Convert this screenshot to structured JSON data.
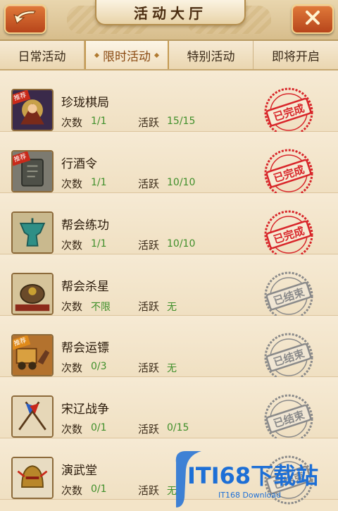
{
  "header": {
    "title": "活动大厅",
    "back_icon": "back-arrow-icon",
    "close_icon": "close-icon"
  },
  "tabs": [
    {
      "label": "日常活动",
      "active": false
    },
    {
      "label": "限时活动",
      "active": true
    },
    {
      "label": "特别活动",
      "active": false
    },
    {
      "label": "即将开启",
      "active": false
    }
  ],
  "labels": {
    "count": "次数",
    "activity": "活跃"
  },
  "activities": [
    {
      "name": "珍珑棋局",
      "count": "1/1",
      "activity": "15/15",
      "status": "已完成",
      "recommended": true,
      "icon": "warrior-portrait-icon"
    },
    {
      "name": "行酒令",
      "count": "1/1",
      "activity": "10/10",
      "status": "已完成",
      "recommended": true,
      "icon": "stone-tablet-icon"
    },
    {
      "name": "帮会练功",
      "count": "1/1",
      "activity": "10/10",
      "status": "已完成",
      "recommended": false,
      "icon": "bronze-vessel-icon"
    },
    {
      "name": "帮会杀星",
      "count": "不限",
      "activity": "无",
      "status": "已结束",
      "recommended": false,
      "icon": "cauldron-icon"
    },
    {
      "name": "帮会运镖",
      "count": "0/3",
      "activity": "无",
      "status": "已结束",
      "recommended": false,
      "icon": "escort-cart-icon"
    },
    {
      "name": "宋辽战争",
      "count": "0/1",
      "activity": "0/15",
      "status": "已结束",
      "recommended": false,
      "icon": "crossed-flags-icon"
    },
    {
      "name": "演武堂",
      "count": "0/1",
      "activity": "无",
      "status": "已结束",
      "recommended": false,
      "icon": "helmet-icon"
    }
  ],
  "recommended_badge": "推荐",
  "watermark": {
    "text": "ITI68下载站",
    "sub": "IT168 Download"
  },
  "colors": {
    "completed": "#d8262a",
    "ended": "#8a8a8a",
    "value_green": "#3f8f2a"
  }
}
